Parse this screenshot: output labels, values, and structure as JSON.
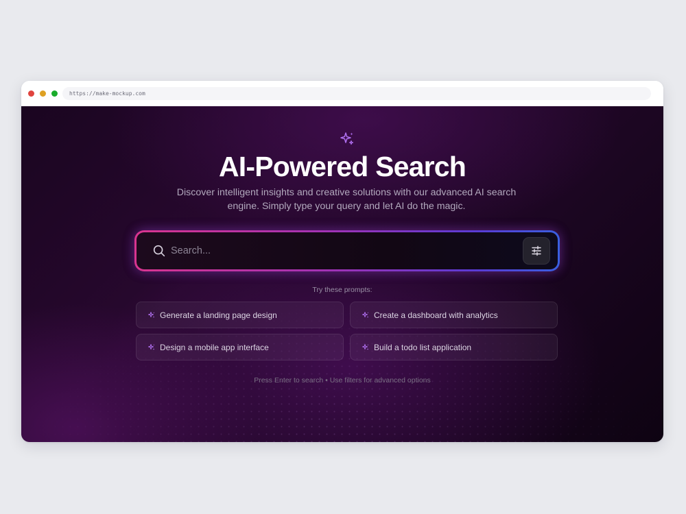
{
  "browser": {
    "url": "https://make-mockup.com"
  },
  "hero": {
    "title": "AI-Powered Search",
    "subtitle": "Discover intelligent insights and creative solutions with our advanced AI search engine. Simply type your query and let AI do the magic.",
    "icon": "sparkles-icon"
  },
  "search": {
    "placeholder": "Search...",
    "value": "",
    "search_icon": "search-icon",
    "filter_icon": "sliders-icon"
  },
  "prompts": {
    "label": "Try these prompts:",
    "items": [
      {
        "label": "Generate a landing page design"
      },
      {
        "label": "Create a dashboard with analytics"
      },
      {
        "label": "Design a mobile app interface"
      },
      {
        "label": "Build a todo list application"
      }
    ]
  },
  "footer": {
    "hint": "Press Enter to search • Use filters for advanced options"
  },
  "colors": {
    "accent_purple": "#b070f0",
    "gradient_start": "#d9358f",
    "gradient_end": "#3a5fe0",
    "background": "#1a0520"
  }
}
